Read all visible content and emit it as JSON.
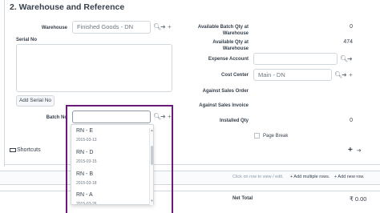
{
  "section": {
    "title": "2. Warehouse and Reference"
  },
  "left": {
    "warehouse_label": "Warehouse",
    "warehouse_value": "Finished Goods - DN",
    "serial_no_label": "Serial No",
    "add_serial_button": "Add Serial No",
    "batch_no_label": "Batch No",
    "batch_no_value": ""
  },
  "right": {
    "available_batch_qty_label": "Available Batch Qty at Warehouse",
    "available_batch_qty_value": "0",
    "available_qty_label": "Available Qty at Warehouse",
    "available_qty_value": "474",
    "expense_account_label": "Expense Account",
    "expense_account_value": "",
    "cost_center_label": "Cost Center",
    "cost_center_value": "Main - DN",
    "against_sales_order_label": "Against Sales Order",
    "against_sales_invoice_label": "Against Sales Invoice",
    "installed_qty_label": "Installed Qty",
    "installed_qty_value": "0",
    "page_break_label": "Page Break"
  },
  "shortcuts": {
    "label": "Shortcuts",
    "add_icon": "+"
  },
  "grid_footer": {
    "hint": "Click on row to view / edit.",
    "add_multiple": "+ Add multiple rows.",
    "add_new": "+ Add new row."
  },
  "totals": {
    "net_total_label": "Net Total",
    "net_total_value": "₹ 0.00"
  },
  "dropdown": {
    "items": [
      {
        "name": "RN - E",
        "date": "2015-03-13"
      },
      {
        "name": "RN - D",
        "date": "2015-03-15"
      },
      {
        "name": "RN - B",
        "date": "2015-03-18"
      },
      {
        "name": "RN - A",
        "date": "2015-03-26"
      }
    ]
  },
  "icons": {
    "search": "search-icon",
    "arrow": "arrow-right-icon",
    "plus": "plus-icon"
  },
  "colors": {
    "highlight": "#6a1b7a",
    "border": "#d1d8dd",
    "text": "#36414c"
  }
}
